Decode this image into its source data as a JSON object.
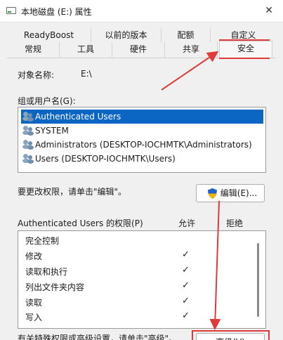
{
  "window": {
    "title": "本地磁盘 (E:) 属性",
    "close_glyph": "✕"
  },
  "tabs_row1": [
    "ReadyBoost",
    "以前的版本",
    "配额",
    "自定义"
  ],
  "tabs_row2": [
    "常规",
    "工具",
    "硬件",
    "共享",
    "安全"
  ],
  "object": {
    "label": "对象名称:",
    "value": "E:\\"
  },
  "groups": {
    "label": "组或用户名(G):",
    "items": [
      "Authenticated Users",
      "SYSTEM",
      "Administrators (DESKTOP-IOCHMTK\\Administrators)",
      "Users (DESKTOP-IOCHMTK\\Users)"
    ]
  },
  "edit": {
    "hint": "要更改权限，请单击\"编辑\"。",
    "button": "编辑(E)..."
  },
  "permissions": {
    "title": "Authenticated Users 的权限(P)",
    "allow": "允许",
    "deny": "拒绝",
    "rows": [
      {
        "name": "完全控制",
        "allow": false
      },
      {
        "name": "修改",
        "allow": true
      },
      {
        "name": "读取和执行",
        "allow": true
      },
      {
        "name": "列出文件夹内容",
        "allow": true
      },
      {
        "name": "读取",
        "allow": true
      },
      {
        "name": "写入",
        "allow": true
      }
    ]
  },
  "advanced": {
    "hint": "有关特殊权限或高级设置，请单击\"高级\"。",
    "button": "高级(V)"
  },
  "check_glyph": "✓",
  "colors": {
    "selection": "#0a66c2",
    "annotation": "#e03a3a"
  }
}
